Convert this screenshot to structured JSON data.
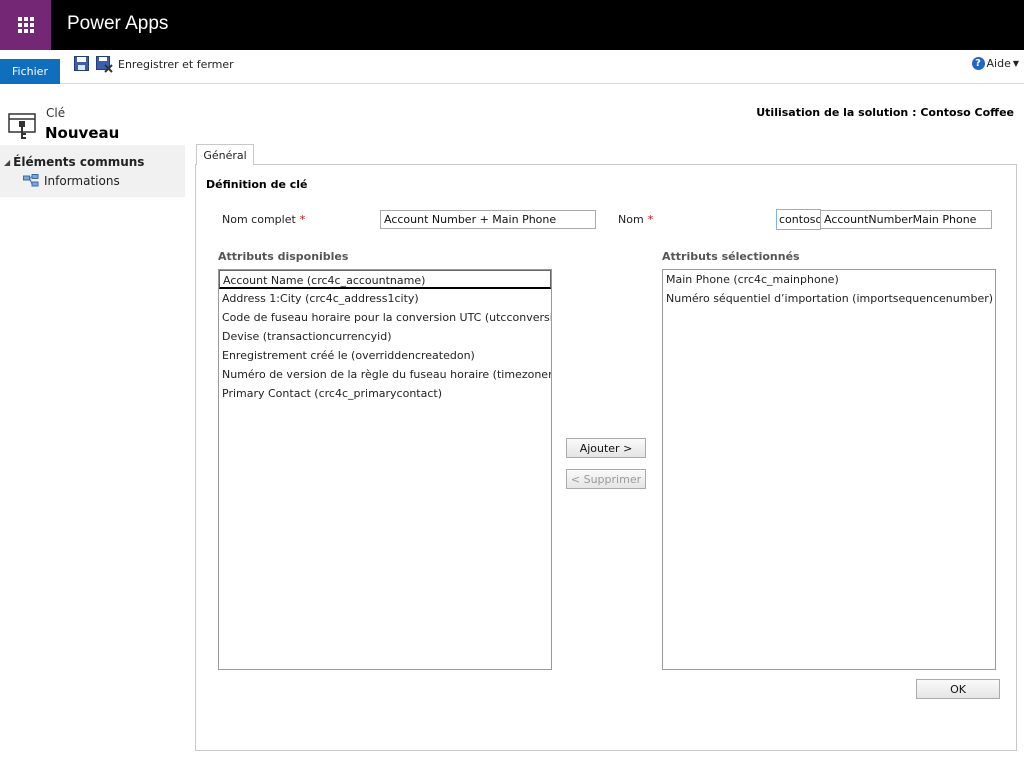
{
  "app": {
    "title": "Power Apps"
  },
  "ribbon": {
    "file_label": "Fichier",
    "save_close_label": "Enregistrer et fermer",
    "help_label": "Aide"
  },
  "entity": {
    "type": "Clé",
    "name": "Nouveau",
    "solution": "Utilisation de la solution : Contoso Coffee"
  },
  "nav": {
    "section": "Éléments communs",
    "items": [
      {
        "label": "Informations"
      }
    ]
  },
  "tabs": [
    {
      "label": "Général"
    }
  ],
  "form": {
    "section_title": "Définition de clé",
    "full_name_label": "Nom complet",
    "full_name_value": "Account Number + Main Phone",
    "name_label": "Nom",
    "name_prefix": "contoso_",
    "name_value": "AccountNumberMain Phone",
    "required_marker": "*"
  },
  "available": {
    "title": "Attributs disponibles",
    "items": [
      "Account Name (crc4c_accountname)",
      "Address 1:City (crc4c_address1city)",
      "Code de fuseau horaire pour la conversion UTC (utcconversiontimezonecode)",
      "Devise (transactioncurrencyid)",
      "Enregistrement créé le (overriddencreatedon)",
      "Numéro de version de la règle du fuseau horaire (timezoneruleversionnumber)",
      "Primary Contact (crc4c_primarycontact)"
    ]
  },
  "selected": {
    "title": "Attributs sélectionnés",
    "items": [
      "Main Phone (crc4c_mainphone)",
      "Numéro séquentiel d’importation (importsequencenumber)"
    ]
  },
  "buttons": {
    "add": "Ajouter >",
    "remove": "< Supprimer",
    "ok": "OK"
  },
  "colors": {
    "topbar": "#000000",
    "waffle": "#742774",
    "file_button": "#106ebe",
    "required": "#cc0000"
  }
}
